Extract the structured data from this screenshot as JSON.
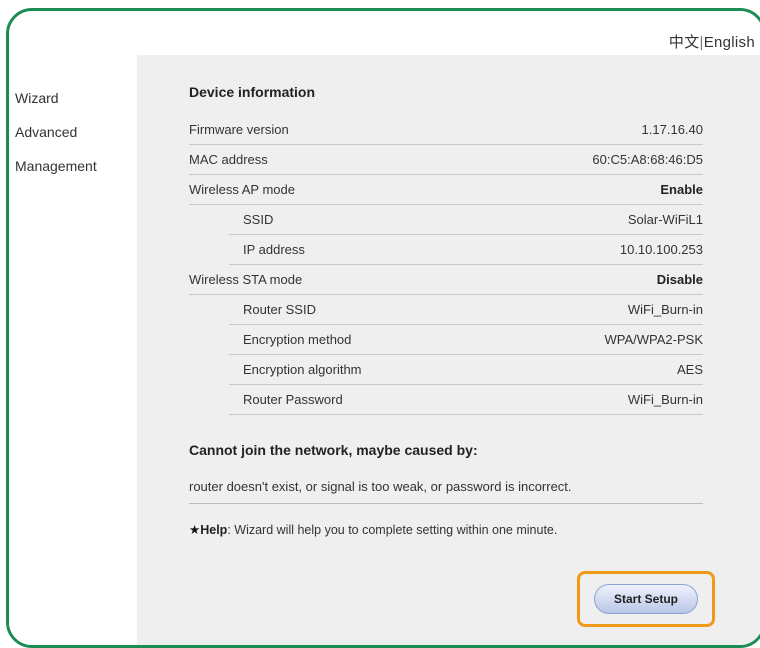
{
  "lang": {
    "zh": "中文",
    "sep": "|",
    "en": "English"
  },
  "sidebar": {
    "items": [
      {
        "label": "Wizard"
      },
      {
        "label": "Advanced"
      },
      {
        "label": "Management"
      }
    ]
  },
  "device": {
    "title": "Device information",
    "rows": [
      {
        "label": "Firmware version",
        "value": "1.17.16.40"
      },
      {
        "label": "MAC address",
        "value": "60:C5:A8:68:46:D5"
      },
      {
        "label": "Wireless AP mode",
        "value": "Enable"
      },
      {
        "label": "SSID",
        "value": "Solar-WiFiL1"
      },
      {
        "label": "IP address",
        "value": "10.10.100.253"
      },
      {
        "label": "Wireless STA mode",
        "value": "Disable"
      },
      {
        "label": "Router SSID",
        "value": "WiFi_Burn-in"
      },
      {
        "label": "Encryption method",
        "value": "WPA/WPA2-PSK"
      },
      {
        "label": "Encryption algorithm",
        "value": "AES"
      },
      {
        "label": "Router Password",
        "value": "WiFi_Burn-in"
      }
    ]
  },
  "warning": {
    "title": "Cannot join the network, maybe caused by:",
    "text": "router doesn't exist, or signal is too weak, or password is incorrect."
  },
  "help": {
    "star": "★",
    "label": "Help",
    "colon": ":",
    "text": "Wizard will help you to complete setting within one minute."
  },
  "actions": {
    "start_setup": "Start Setup"
  },
  "colors": {
    "frame_border": "#1b8c56",
    "highlight_border": "#f09a1a",
    "panel_bg": "#efefef"
  }
}
